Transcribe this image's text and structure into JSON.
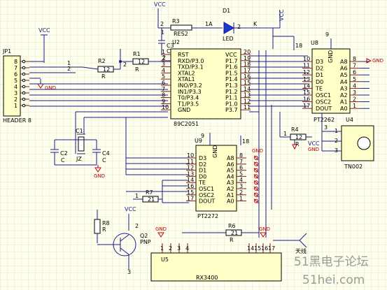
{
  "colors": {
    "grid": "#e7e7c4",
    "background": "#fffff0",
    "wire": "#1a1a8c",
    "ground": "#c00000"
  },
  "jp1": {
    "ref": "JP1",
    "name": "HEADER 8",
    "pins": [
      "8",
      "7",
      "6",
      "5",
      "4",
      "3",
      "2",
      "1"
    ]
  },
  "power": {
    "vcc": "VCC",
    "gnd": "GND"
  },
  "u2": {
    "ref": "U2",
    "part": "89C2051",
    "left_pins": [
      {
        "num": "1",
        "name": "RST"
      },
      {
        "num": "2",
        "name": "RXD/P3.0"
      },
      {
        "num": "3",
        "name": "TXD/P3.1"
      },
      {
        "num": "4",
        "name": "XTAL2"
      },
      {
        "num": "5",
        "name": "XTAL1"
      },
      {
        "num": "6",
        "name": "INO/P3.2"
      },
      {
        "num": "7",
        "name": "IN1/P3.3"
      },
      {
        "num": "8",
        "name": "T0/P3.4"
      },
      {
        "num": "9",
        "name": "T1/P3.5"
      },
      {
        "num": "10",
        "name": "GND"
      }
    ],
    "right_pins": [
      {
        "num": "20",
        "name": "VCC"
      },
      {
        "num": "19",
        "name": "P1.7"
      },
      {
        "num": "18",
        "name": "P1.6"
      },
      {
        "num": "17",
        "name": "P1.5"
      },
      {
        "num": "16",
        "name": "P1.4"
      },
      {
        "num": "15",
        "name": "P1.3"
      },
      {
        "num": "14",
        "name": "P1.2"
      },
      {
        "num": "13",
        "name": "P1.1"
      },
      {
        "num": "12",
        "name": "P1.0"
      },
      {
        "num": "11",
        "name": "P3.7"
      }
    ]
  },
  "u8": {
    "ref": "U8",
    "part": "PT2262",
    "gnd_label": "GND",
    "gnd_pin": "9",
    "left_pins": [
      {
        "num": "10",
        "name": "D3"
      },
      {
        "num": "11",
        "name": "D2"
      },
      {
        "num": "12",
        "name": "D1"
      },
      {
        "num": "13",
        "name": "D0"
      },
      {
        "num": "14",
        "name": "TE"
      },
      {
        "num": "15",
        "name": "OSC1"
      },
      {
        "num": "16",
        "name": "OSC2"
      },
      {
        "num": "17",
        "name": "DOUT"
      }
    ],
    "right_pins": [
      {
        "num": "8",
        "name": "A8"
      },
      {
        "num": "7",
        "name": "A6"
      },
      {
        "num": "6",
        "name": "A5"
      },
      {
        "num": "5",
        "name": "A4"
      },
      {
        "num": "4",
        "name": "A3"
      },
      {
        "num": "3",
        "name": "A2"
      },
      {
        "num": "2",
        "name": "A1"
      },
      {
        "num": "1",
        "name": "A0"
      }
    ],
    "top_pin": "18"
  },
  "u9": {
    "ref": "U9",
    "part": "PT2272",
    "gnd_label": "GND",
    "gnd_pin": "9",
    "left_pins": [
      {
        "num": "10",
        "name": "D3"
      },
      {
        "num": "11",
        "name": "D2"
      },
      {
        "num": "12",
        "name": "D1"
      },
      {
        "num": "13",
        "name": "D0"
      },
      {
        "num": "14",
        "name": "TE"
      },
      {
        "num": "16",
        "name": "OSC1"
      },
      {
        "num": "15",
        "name": "OSC2"
      },
      {
        "num": "17",
        "name": "DOUT"
      }
    ],
    "right_pins": [
      {
        "num": "8",
        "name": "A8"
      },
      {
        "num": "7",
        "name": "A6"
      },
      {
        "num": "6",
        "name": "A5"
      },
      {
        "num": "5",
        "name": "A4"
      },
      {
        "num": "4",
        "name": "A3"
      },
      {
        "num": "3",
        "name": "A2"
      },
      {
        "num": "2",
        "name": "A1"
      },
      {
        "num": "1",
        "name": "A0"
      }
    ],
    "top_pin": "18"
  },
  "u4": {
    "ref": "U4",
    "part": "TN002",
    "pins": [
      "1",
      "2",
      "3"
    ]
  },
  "u5": {
    "ref": "U5",
    "part": "RX3400",
    "pins": [
      "1",
      "2",
      "3",
      "4",
      "14",
      "15",
      "16",
      "17"
    ],
    "antenna": "天线"
  },
  "q2": {
    "ref": "Q2",
    "part": "PNP"
  },
  "led": {
    "ref": "D1",
    "name": "LED",
    "anode": "1A",
    "cathode": "K"
  },
  "resistors": {
    "r1": {
      "ref": "R1",
      "value": "12",
      "type": "R"
    },
    "r2": {
      "ref": "R2",
      "value": "12",
      "type": "R"
    },
    "r3": {
      "ref": "R3",
      "value": "RES2"
    },
    "r4": {
      "ref": "R4",
      "value": "12",
      "type": "R"
    },
    "r6": {
      "ref": "R6",
      "value": "21",
      "type": "R"
    },
    "r7": {
      "ref": "R7",
      "value": "21",
      "type": "R"
    },
    "r8": {
      "ref": "R8",
      "value": "",
      "type": "R"
    }
  },
  "caps": {
    "c1": {
      "ref": "C1",
      "type": "C"
    },
    "c2": {
      "ref": "C2",
      "type": "C"
    },
    "c3": {
      "ref": "C3",
      "type": "C"
    },
    "c4": {
      "ref": "C4",
      "type": "C"
    }
  },
  "crystal": {
    "ref": "Y1",
    "label": "JZ"
  },
  "net_labels": {
    "vcc_top": "VCC",
    "l18a": "18",
    "l18b": "18",
    "l9": "9",
    "i1": "1",
    "i2": "2",
    "i3": "3",
    "i4": "4",
    "i5": "5",
    "i6": "6",
    "i7": "7",
    "i8": "8",
    "i9": "9",
    "i10": "10",
    "i11": "11",
    "i12": "12",
    "i13": "13",
    "i14": "14",
    "i15": "15",
    "i16": "16",
    "i17": "17",
    "i18": "18",
    "i19": "19",
    "i20": "20",
    "i2b": "2",
    "i3b": "3",
    "i4b": "4",
    "i1b": "1",
    "i2c": "2",
    "i1c": "1",
    "i2d": "2",
    "i1d": "1",
    "i3c": "3",
    "i1e": "1",
    "i2e": "2",
    "i3d": "3",
    "i4d": "4"
  },
  "watermark": {
    "cn": "51黑电子论坛",
    "url": "51hei.com"
  }
}
